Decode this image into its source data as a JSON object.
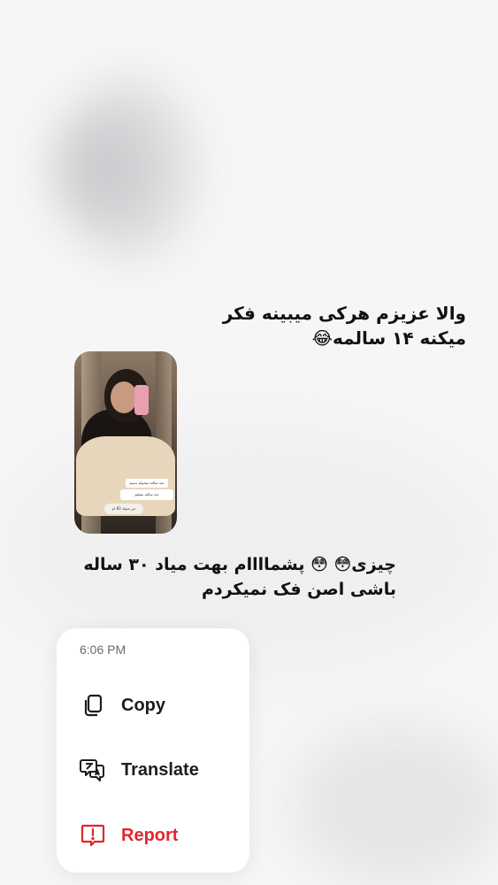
{
  "messages": {
    "outgoing_text": "والا عزیزم هرکی میبینه فکر میکنه ۱۴ سالمه😂",
    "story_reply": {
      "overlay_question": "جند سالته میخوام بدونم",
      "overlay_answer": "جند سالته منفقم",
      "overlay_footer": "من متولد 83 ام"
    },
    "incoming_text": "چیزی😳 😳 پشماااام بهت  میاد ۳۰ ساله باشی اصن فک نمیکردم"
  },
  "context_menu": {
    "timestamp": "6:06 PM",
    "items": [
      {
        "label": "Copy",
        "icon": "copy-icon"
      },
      {
        "label": "Translate",
        "icon": "translate-icon"
      },
      {
        "label": "Report",
        "icon": "report-icon",
        "color": "#e0262d"
      }
    ]
  }
}
